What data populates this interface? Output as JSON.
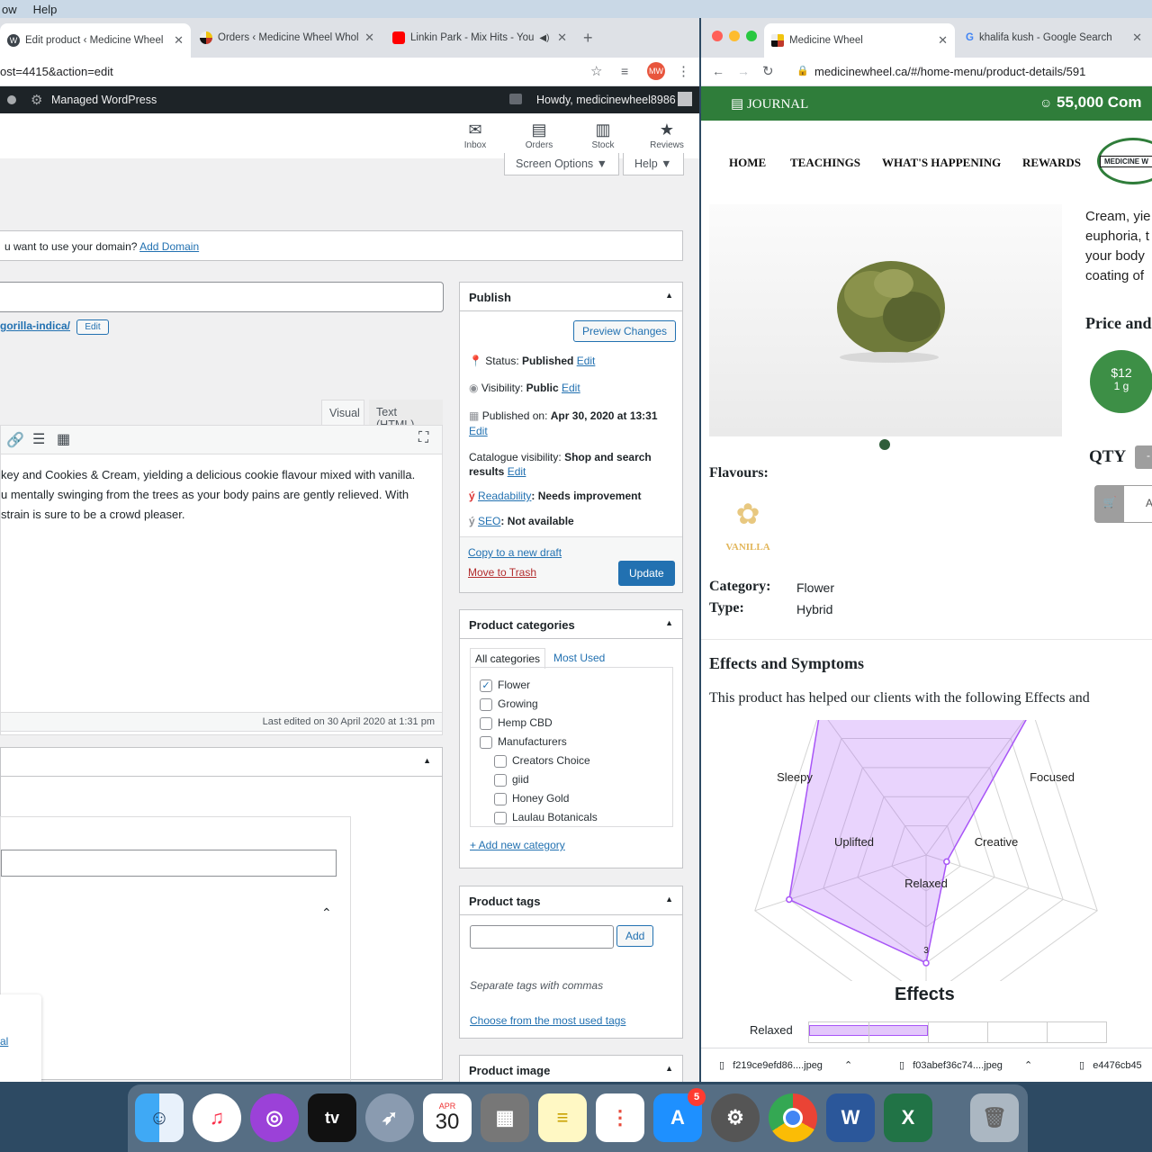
{
  "menubar": {
    "items": [
      "ow",
      "Help"
    ]
  },
  "left_browser": {
    "tabs": [
      {
        "label": "Edit product ‹ Medicine Wheel",
        "icon": "wordpress-icon"
      },
      {
        "label": "Orders ‹ Medicine Wheel Whol",
        "icon": "medicine-wheel-icon"
      },
      {
        "label": "Linkin Park - Mix Hits - You",
        "icon": "youtube-icon"
      }
    ],
    "url": "ost=4415&action=edit",
    "avatar": "MW"
  },
  "wp_admin_bar": {
    "site": "Managed WordPress",
    "howdy": "Howdy, medicinewheel8986"
  },
  "wc_bar": [
    {
      "label": "Inbox",
      "icon": "inbox-icon"
    },
    {
      "label": "Orders",
      "icon": "orders-icon"
    },
    {
      "label": "Stock",
      "icon": "stock-icon"
    },
    {
      "label": "Reviews",
      "icon": "star-icon"
    }
  ],
  "screen_options": "Screen Options ▼",
  "help": "Help ▼",
  "domain_notice": {
    "text": "u want to use your domain?",
    "link": "Add Domain"
  },
  "permalink": {
    "slug": "gorilla-indica/",
    "edit": "Edit"
  },
  "editor": {
    "tab_visual": "Visual",
    "tab_text": "Text (HTML)",
    "content_lines": [
      "key and Cookies & Cream, yielding a delicious cookie flavour mixed with vanilla.",
      "u mentally swinging from the trees as your body pains are gently relieved. With",
      " strain is sure to be a crowd pleaser."
    ],
    "last_edited": "Last edited on 30 April 2020 at 1:31 pm"
  },
  "publish": {
    "title": "Publish",
    "preview": "Preview Changes",
    "status_label": "Status:",
    "status_value": "Published",
    "visibility_label": "Visibility:",
    "visibility_value": "Public",
    "published_label": "Published on:",
    "published_value": "Apr 30, 2020 at 13:31",
    "edit": "Edit",
    "catalogue_label": "Catalogue visibility:",
    "catalogue_value": "Shop and search results",
    "readability_link": "Readability",
    "readability_value": ": Needs improvement",
    "seo_link": "SEO",
    "seo_value": ": Not available",
    "copy_draft": "Copy to a new draft",
    "trash": "Move to Trash",
    "update": "Update"
  },
  "categories": {
    "title": "Product categories",
    "tab_all": "All categories",
    "tab_used": "Most Used",
    "items": [
      {
        "label": "Flower",
        "checked": true,
        "indent": 0
      },
      {
        "label": "Growing",
        "checked": false,
        "indent": 0
      },
      {
        "label": "Hemp CBD",
        "checked": false,
        "indent": 0
      },
      {
        "label": "Manufacturers",
        "checked": false,
        "indent": 0
      },
      {
        "label": "Creators Choice",
        "checked": false,
        "indent": 1
      },
      {
        "label": "giid",
        "checked": false,
        "indent": 1
      },
      {
        "label": "Honey Gold",
        "checked": false,
        "indent": 1
      },
      {
        "label": "Laulau Botanicals",
        "checked": false,
        "indent": 1
      }
    ],
    "add_new": "+ Add new category"
  },
  "tags": {
    "title": "Product tags",
    "add": "Add",
    "hint": "Separate tags with commas",
    "choose": "Choose from the most used tags"
  },
  "product_image": {
    "title": "Product image"
  },
  "side_link": "al",
  "right_browser": {
    "tabs": [
      {
        "label": "Medicine Wheel",
        "icon": "medicine-wheel-icon"
      },
      {
        "label": "khalifa kush - Google Search",
        "icon": "google-icon"
      }
    ],
    "url": "medicinewheel.ca/#/home-menu/product-details/591"
  },
  "site": {
    "journal": "JOURNAL",
    "community": "55,000 Com",
    "nav": [
      "HOME",
      "TEACHINGS",
      "WHAT'S HAPPENING",
      "REWARDS"
    ],
    "logo_text": "MEDICINE W",
    "description_lines": [
      "Cream, yie",
      "euphoria, t",
      "your body",
      "coating of"
    ],
    "price_heading": "Price and",
    "price": "$12",
    "price_unit": "1 g",
    "qty_label": "QTY",
    "qty_minus": "-",
    "cart_text": "A",
    "flavours_label": "Flavours:",
    "flavour": "VANILLA",
    "category_label": "Category:",
    "category_value": "Flower",
    "type_label": "Type:",
    "type_value": "Hybrid",
    "effects_heading": "Effects and Symptoms",
    "effects_text": "This product has helped our clients with the following Effects and",
    "effects_bar_title": "Effects",
    "effects_bar_label": "Relaxed",
    "accent": "#2f7d3a"
  },
  "chart_data": {
    "type": "radar",
    "categories": [
      "Relaxed",
      "Creative",
      "Focused",
      "Sleepy",
      "Uplifted"
    ],
    "values": [
      3,
      4,
      5,
      5,
      0.6
    ],
    "range": [
      0,
      5
    ],
    "tick_label": "3",
    "color": "#a855f7"
  },
  "downloads": [
    {
      "name": "f219ce9efd86....jpeg"
    },
    {
      "name": "f03abef36c74....jpeg"
    },
    {
      "name": "e4476cb45"
    }
  ],
  "dock": {
    "calendar_month": "APR",
    "calendar_day": "30",
    "appstore_badge": "5",
    "tv_label": "tv"
  }
}
